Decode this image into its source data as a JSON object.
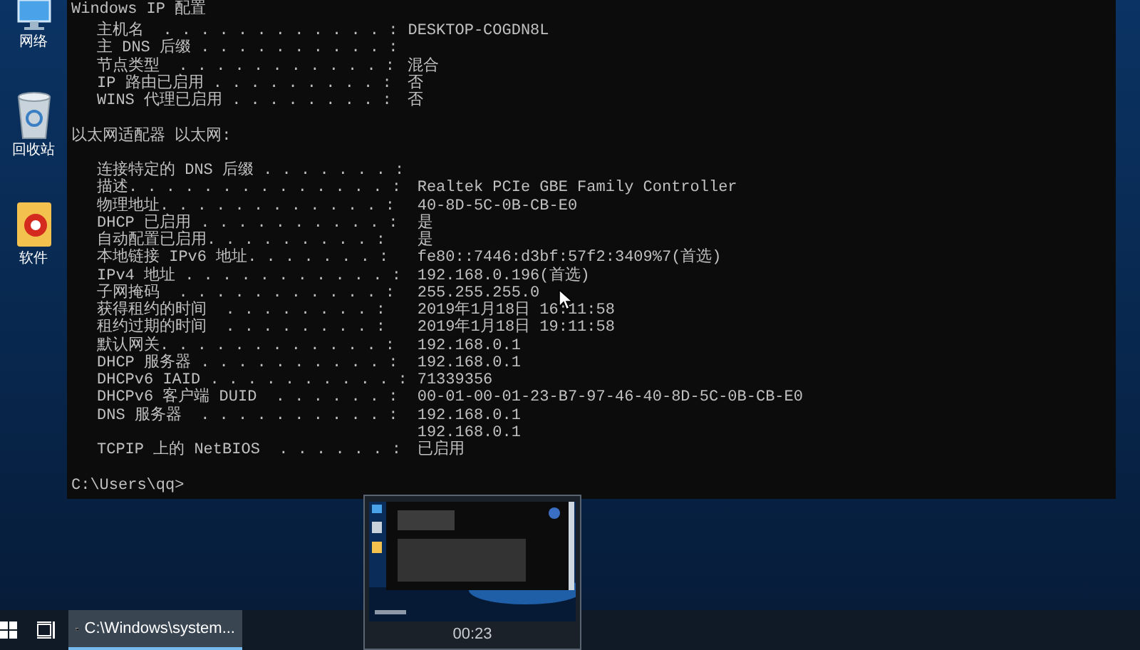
{
  "desktop_icons": [
    {
      "kind": "network",
      "label": "网络"
    },
    {
      "kind": "recycle",
      "label": "回收站"
    },
    {
      "kind": "software",
      "label": "软件"
    }
  ],
  "console": {
    "title_line": "Windows IP 配置",
    "sections": [
      {
        "rows": [
          {
            "label": "主机名  . . . . . . . . . . . . :",
            "value": "DESKTOP-COGDN8L"
          },
          {
            "label": "主 DNS 后缀 . . . . . . . . . . :"
          },
          {
            "label": "节点类型  . . . . . . . . . . . :",
            "value": "混合"
          },
          {
            "label": "IP 路由已启用 . . . . . . . . . :",
            "value": "否"
          },
          {
            "label": "WINS 代理已启用 . . . . . . . . :",
            "value": "否"
          }
        ]
      },
      {
        "heading": "以太网适配器 以太网:",
        "rows": [
          {
            "label": "连接特定的 DNS 后缀 . . . . . . . :"
          },
          {
            "label": "描述. . . . . . . . . . . . . . :",
            "value": "Realtek PCIe GBE Family Controller"
          },
          {
            "label": "物理地址. . . . . . . . . . . . :",
            "value": "40-8D-5C-0B-CB-E0"
          },
          {
            "label": "DHCP 已启用 . . . . . . . . . . :",
            "value": "是"
          },
          {
            "label": "自动配置已启用. . . . . . . . . :",
            "value": "是"
          },
          {
            "label": "本地链接 IPv6 地址. . . . . . . :",
            "value": "fe80::7446:d3bf:57f2:3409%7(首选)"
          },
          {
            "label": "IPv4 地址 . . . . . . . . . . . :",
            "value": "192.168.0.196(首选)"
          },
          {
            "label": "子网掩码  . . . . . . . . . . . :",
            "value": "255.255.255.0"
          },
          {
            "label": "获得租约的时间  . . . . . . . . :",
            "value": "2019年1月18日 16:11:58"
          },
          {
            "label": "租约过期的时间  . . . . . . . . :",
            "value": "2019年1月18日 19:11:58"
          },
          {
            "label": "默认网关. . . . . . . . . . . . :",
            "value": "192.168.0.1"
          },
          {
            "label": "DHCP 服务器 . . . . . . . . . . :",
            "value": "192.168.0.1"
          },
          {
            "label": "DHCPv6 IAID . . . . . . . . . . :",
            "value": "71339356"
          },
          {
            "label": "DHCPv6 客户端 DUID  . . . . . . :",
            "value": "00-01-00-01-23-B7-97-46-40-8D-5C-0B-CB-E0"
          },
          {
            "label": "DNS 服务器  . . . . . . . . . . :",
            "value": "192.168.0.1"
          },
          {
            "value": "192.168.0.1"
          },
          {
            "label": "TCPIP 上的 NetBIOS  . . . . . . :",
            "value": "已启用"
          }
        ]
      }
    ],
    "prompt": "C:\\Users\\qq>"
  },
  "thumbnail": {
    "time": "00:23"
  },
  "taskbar": {
    "buttons": [
      {
        "label": "C:\\Windows\\system...",
        "selected": true
      }
    ]
  }
}
